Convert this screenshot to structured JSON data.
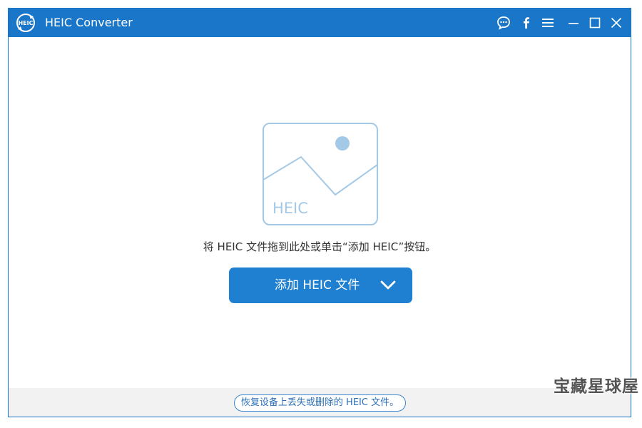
{
  "window": {
    "title": "HEIC Converter",
    "logo_text": "HEIC"
  },
  "titlebar_icons": {
    "feedback": "chat-bubble-icon",
    "facebook": "facebook-icon",
    "menu": "menu-icon",
    "minimize": "minimize-icon",
    "maximize": "maximize-icon",
    "close": "close-icon"
  },
  "main": {
    "placeholder_label": "HEIC",
    "hint": "将 HEIC 文件拖到此处或单击“添加 HEIC”按钮。",
    "add_button_label": "添加 HEIC 文件"
  },
  "footer": {
    "recover_link": "恢复设备上丢失或删除的 HEIC 文件。"
  },
  "watermark": "宝藏星球屋",
  "colors": {
    "titlebar": "#1976c8",
    "accent": "#1f7fd0",
    "placeholder": "#a4c9e6",
    "footer": "#f2f2f2"
  }
}
